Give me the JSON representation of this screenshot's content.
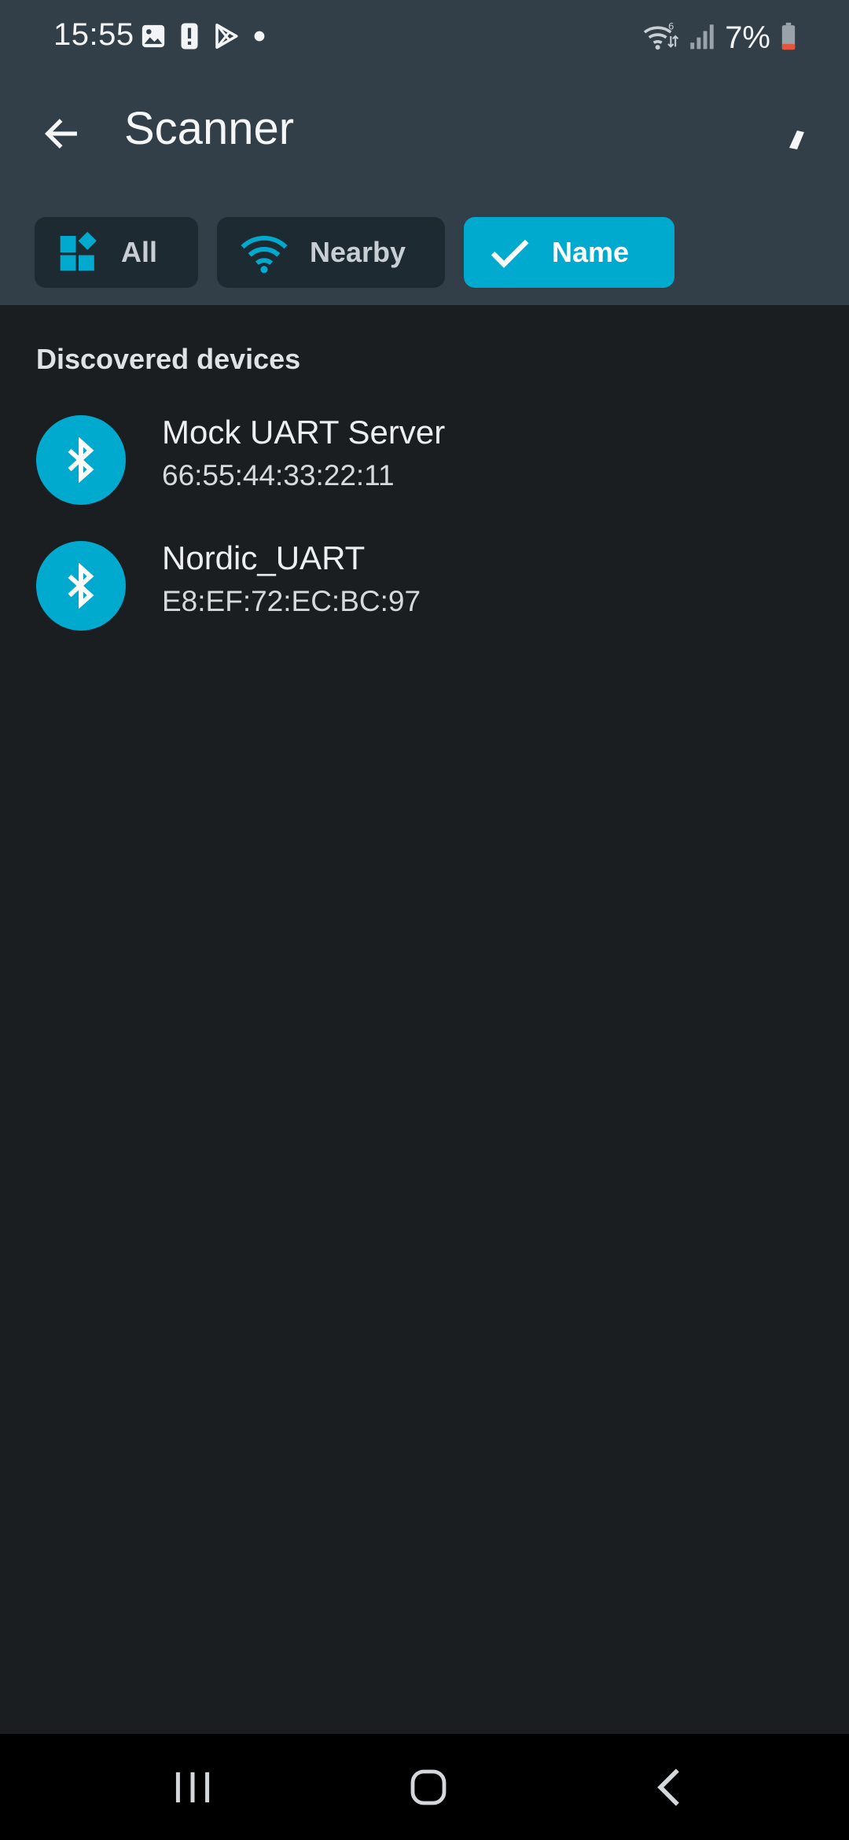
{
  "status_bar": {
    "time": "15:55",
    "left_icons": [
      "gallery-icon",
      "alert-icon",
      "play-store-icon",
      "dot-icon"
    ],
    "right_icons": [
      "wifi-icon",
      "signal-icon",
      "battery-icon"
    ],
    "battery": "7%"
  },
  "app_bar": {
    "title": "Scanner",
    "back_icon": "arrow-back-icon"
  },
  "filters": [
    {
      "label": "All",
      "icon": "dashboard-icon",
      "selected": false
    },
    {
      "label": "Nearby",
      "icon": "wifi-icon",
      "selected": false
    },
    {
      "label": "Name",
      "icon": "check-icon",
      "selected": true
    }
  ],
  "section": {
    "title": "Discovered devices"
  },
  "devices": [
    {
      "name": "Mock UART Server",
      "address": "66:55:44:33:22:11",
      "icon": "bluetooth-icon"
    },
    {
      "name": "Nordic_UART",
      "address": "E8:EF:72:EC:BC:97",
      "icon": "bluetooth-icon"
    }
  ],
  "nav_bar": {
    "items": [
      "recents-icon",
      "home-icon",
      "back-icon"
    ]
  },
  "colors": {
    "accent": "#00a9ce",
    "header_bg": "#323e48",
    "body_bg": "#1b1e21",
    "chip_bg": "#1e2a32"
  }
}
